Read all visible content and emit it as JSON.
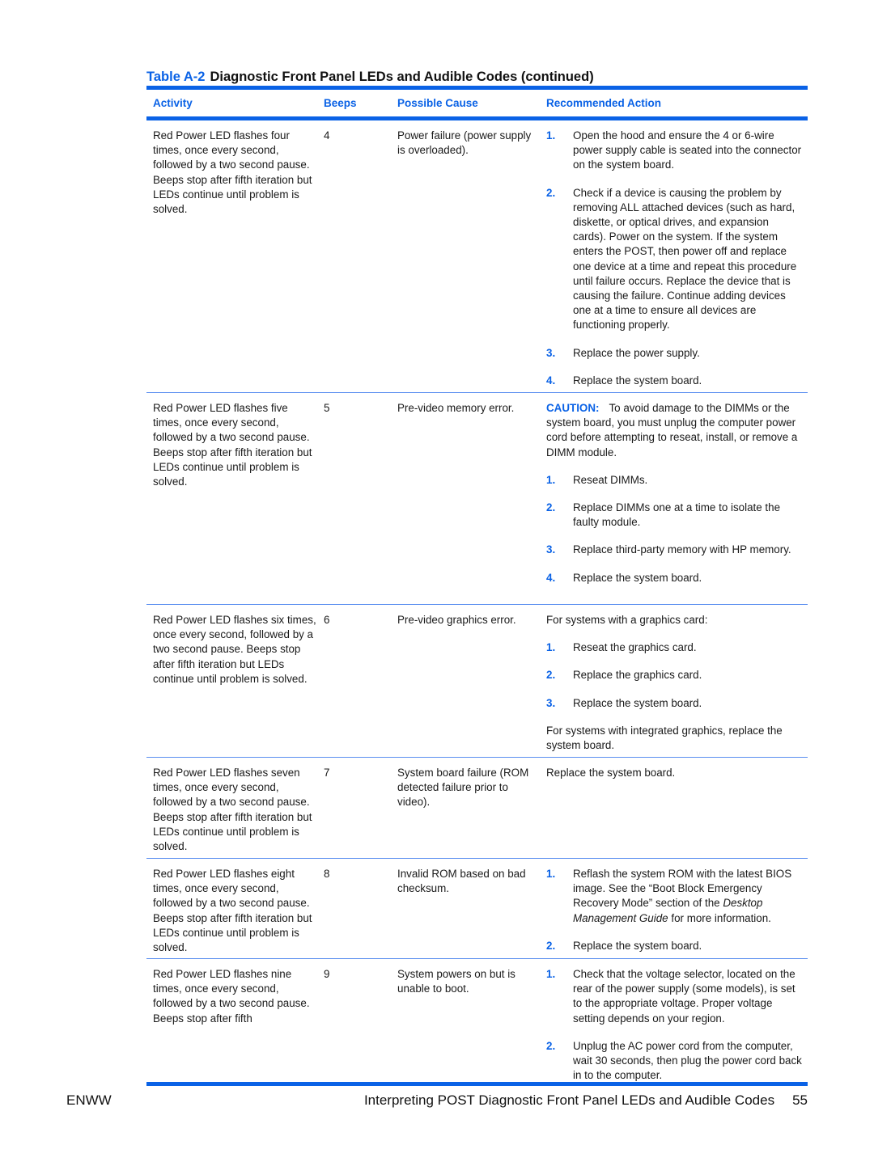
{
  "table": {
    "label": "Table A-2",
    "title": "Diagnostic Front Panel LEDs and Audible Codes (continued)",
    "columns": [
      "Activity",
      "Beeps",
      "Possible Cause",
      "Recommended Action"
    ],
    "rows": [
      {
        "activity": "Red Power LED flashes four times, once every second, followed by a two second pause. Beeps stop after fifth iteration but LEDs continue until problem is solved.",
        "beeps": "4",
        "cause": "Power failure (power supply is overloaded).",
        "action": {
          "steps": [
            {
              "num": "1.",
              "text": "Open the hood and ensure the 4 or 6-wire power supply cable is seated into the connector on the system board."
            },
            {
              "num": "2.",
              "text": "Check if a device is causing the problem by removing ALL attached devices (such as hard, diskette, or optical drives, and expansion cards). Power on the system. If the system enters the POST, then power off and replace one device at a time and repeat this procedure until failure occurs. Replace the device that is causing the failure. Continue adding devices one at a time to ensure all devices are functioning properly."
            },
            {
              "num": "3.",
              "text": "Replace the power supply."
            },
            {
              "num": "4.",
              "text": "Replace the system board."
            }
          ]
        }
      },
      {
        "activity": "Red Power LED flashes five times, once every second, followed by a two second pause. Beeps stop after fifth iteration but LEDs continue until problem is solved.",
        "beeps": "5",
        "cause": "Pre-video memory error.",
        "action": {
          "caution_label": "CAUTION:",
          "caution_text": "To avoid damage to the DIMMs or the system board, you must unplug the computer power cord before attempting to reseat, install, or remove a DIMM module.",
          "steps": [
            {
              "num": "1.",
              "text": "Reseat DIMMs."
            },
            {
              "num": "2.",
              "text": "Replace DIMMs one at a time to isolate the faulty module."
            },
            {
              "num": "3.",
              "text": "Replace third-party memory with HP memory."
            },
            {
              "num": "4.",
              "text": "Replace the system board."
            }
          ]
        }
      },
      {
        "activity": "Red Power LED flashes six times, once every second, followed by a two second pause. Beeps stop after fifth iteration but LEDs continue until problem is solved.",
        "beeps": "6",
        "cause": "Pre-video graphics error.",
        "action": {
          "intro": "For systems with a graphics card:",
          "steps": [
            {
              "num": "1.",
              "text": "Reseat the graphics card."
            },
            {
              "num": "2.",
              "text": "Replace the graphics card."
            },
            {
              "num": "3.",
              "text": "Replace the system board."
            }
          ],
          "outro": "For systems with integrated graphics, replace the system board."
        }
      },
      {
        "activity": "Red Power LED flashes seven times, once every second, followed by a two second pause. Beeps stop after fifth iteration but LEDs continue until problem is solved.",
        "beeps": "7",
        "cause": "System board failure (ROM detected failure prior to video).",
        "action": {
          "text": "Replace the system board."
        }
      },
      {
        "activity": "Red Power LED flashes eight times, once every second, followed by a two second pause. Beeps stop after fifth iteration but LEDs continue until problem is solved.",
        "beeps": "8",
        "cause": "Invalid ROM based on bad checksum.",
        "action": {
          "steps": [
            {
              "num": "1.",
              "text_before": "Reflash the system ROM with the latest BIOS image. See the “Boot Block Emergency Recovery Mode” section of the ",
              "text_italic": "Desktop Management Guide",
              "text_after": " for more information."
            },
            {
              "num": "2.",
              "text": "Replace the system board."
            }
          ]
        }
      },
      {
        "activity": "Red Power LED flashes nine times, once every second, followed by a two second pause. Beeps stop after fifth",
        "beeps": "9",
        "cause": "System powers on but is unable to boot.",
        "action": {
          "steps": [
            {
              "num": "1.",
              "text": "Check that the voltage selector, located on the rear of the power supply (some models), is set to the appropriate voltage. Proper voltage setting depends on your region."
            },
            {
              "num": "2.",
              "text": "Unplug the AC power cord from the computer, wait 30 seconds, then plug the power cord back in to the computer."
            }
          ]
        }
      }
    ]
  },
  "footer": {
    "left": "ENWW",
    "section": "Interpreting POST Diagnostic Front Panel LEDs and Audible Codes",
    "page": "55"
  },
  "colors": {
    "accent": "#0a62e6",
    "row_rule": "#5b8ff0",
    "text": "#1a1a1a"
  }
}
